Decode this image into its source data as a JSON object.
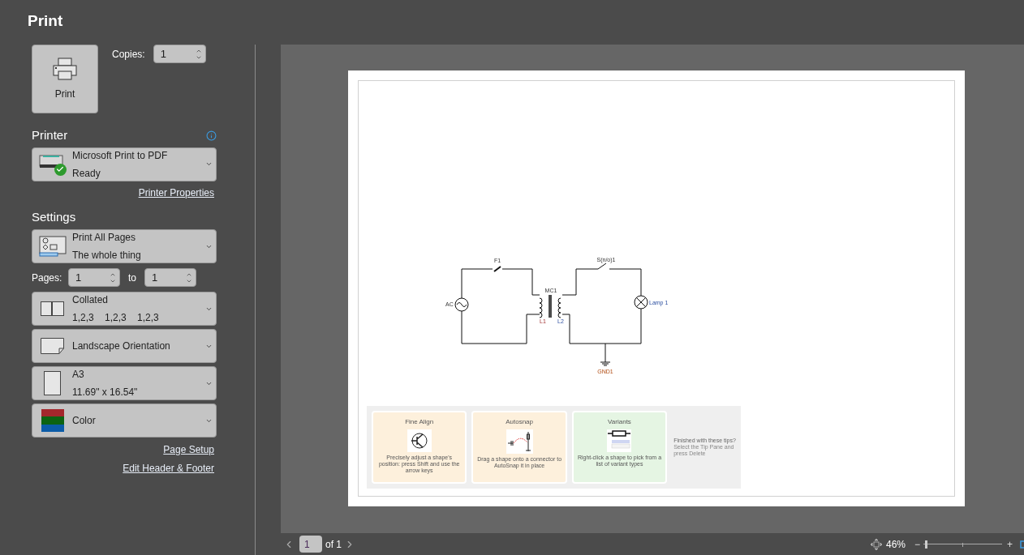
{
  "title": "Print",
  "print_button": {
    "label": "Print"
  },
  "copies": {
    "label": "Copies:",
    "value": "1"
  },
  "printer": {
    "heading": "Printer",
    "name": "Microsoft Print to PDF",
    "status": "Ready",
    "ready": true,
    "properties_link": "Printer Properties"
  },
  "settings": {
    "heading": "Settings",
    "items": [
      {
        "kind": "diagram",
        "primary": "Print All Pages",
        "secondary": "The whole thing"
      },
      {
        "kind": "pages",
        "label": "Pages:",
        "from": "1",
        "to_label": "to",
        "to": "1"
      },
      {
        "kind": "collate",
        "primary": "Collated",
        "secondary": "1,2,3    1,2,3    1,2,3"
      },
      {
        "kind": "orientation",
        "primary": "Landscape Orientation"
      },
      {
        "kind": "paper",
        "primary": "A3",
        "secondary": "11.69\" x 16.54\""
      },
      {
        "kind": "color",
        "primary": "Color"
      }
    ]
  },
  "links": [
    "Page Setup",
    "Edit Header & Footer"
  ],
  "preview": {
    "circuit_labels": {
      "fuse": "F1",
      "switch": "S(n/o)1",
      "transformer": "MC1",
      "source": "AC",
      "coil_1": "L1",
      "coil_2": "L2",
      "lamp": "Lamp 1",
      "ground": "GND1"
    },
    "tips": [
      {
        "kind": "align",
        "title": "Fine Align",
        "text": "Precisely adjust a shape's position: press Shift and use the arrow keys",
        "color": "#fdf0dc"
      },
      {
        "kind": "snap",
        "title": "Autosnap",
        "text": "Drag a shape onto a connector to AutoSnap it in place",
        "color": "#fdf0dc"
      },
      {
        "kind": "variants",
        "title": "Variants",
        "text": "Right-click a shape to pick from a list of variant types",
        "color": "#e5f5e3"
      }
    ],
    "tips_done": {
      "title": "Finished with these tips?",
      "text": "Select the Tip Pane and press Delete"
    }
  },
  "navigation": {
    "page": "1",
    "of": "of 1"
  },
  "zoom": {
    "value": "46%",
    "minus": "−",
    "plus": "+",
    "level": 0.02
  }
}
